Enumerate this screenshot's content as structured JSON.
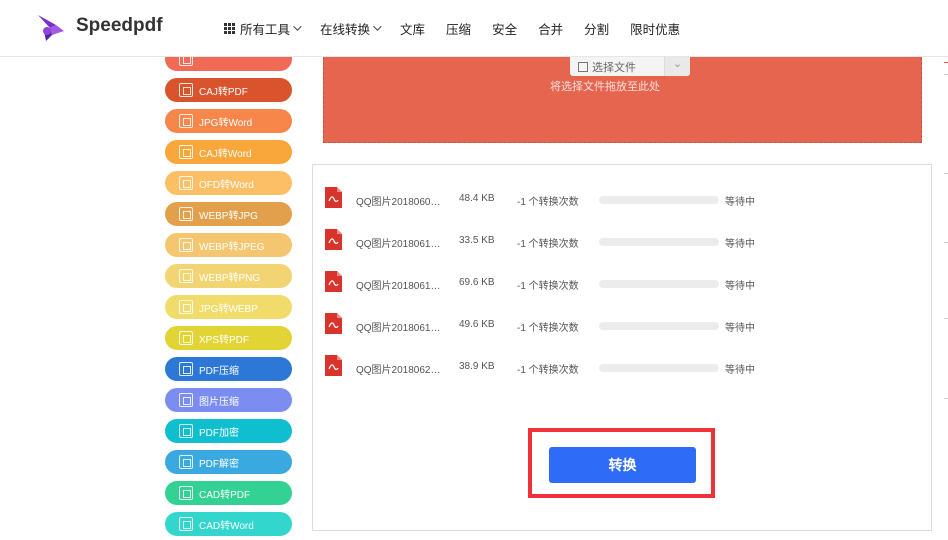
{
  "header": {
    "brand": "Speedpdf",
    "nav": [
      {
        "label": "所有工具",
        "has_grid_icon": true,
        "has_chevron": true
      },
      {
        "label": "在线转换",
        "has_grid_icon": false,
        "has_chevron": true
      },
      {
        "label": "文库",
        "has_grid_icon": false,
        "has_chevron": false
      },
      {
        "label": "压缩",
        "has_grid_icon": false,
        "has_chevron": false
      },
      {
        "label": "安全",
        "has_grid_icon": false,
        "has_chevron": false
      },
      {
        "label": "合并",
        "has_grid_icon": false,
        "has_chevron": false
      },
      {
        "label": "分割",
        "has_grid_icon": false,
        "has_chevron": false
      },
      {
        "label": "限时优惠",
        "has_grid_icon": false,
        "has_chevron": false
      }
    ]
  },
  "sidebar": {
    "items": [
      {
        "label": "",
        "color": "#f06a55"
      },
      {
        "label": "CAJ转PDF",
        "color": "#d9532c"
      },
      {
        "label": "JPG转Word",
        "color": "#f7864a"
      },
      {
        "label": "CAJ转Word",
        "color": "#f9a63a"
      },
      {
        "label": "OFD转Word",
        "color": "#fdbf66"
      },
      {
        "label": "WEBP转JPG",
        "color": "#e3a04c"
      },
      {
        "label": "WEBP转JPEG",
        "color": "#f4c670"
      },
      {
        "label": "WEBP转PNG",
        "color": "#f2d572"
      },
      {
        "label": "JPG转WEBP",
        "color": "#f1dc6b"
      },
      {
        "label": "XPS转PDF",
        "color": "#e3d436"
      },
      {
        "label": "PDF压缩",
        "color": "#2d78d6"
      },
      {
        "label": "图片压缩",
        "color": "#7b8df0"
      },
      {
        "label": "PDF加密",
        "color": "#10bfcf"
      },
      {
        "label": "PDF解密",
        "color": "#3aa9e0"
      },
      {
        "label": "CAD转PDF",
        "color": "#33d294"
      },
      {
        "label": "CAD转Word",
        "color": "#32d6cc"
      },
      {
        "label": "",
        "color": "#39c56a"
      }
    ]
  },
  "upload": {
    "select_label": "选择文件",
    "drop_hint": "将选择文件拖放至此处",
    "bg_color": "#e5654f"
  },
  "files": [
    {
      "name": "QQ图片2018060…",
      "size": "48.4 KB",
      "count": "-1 个转换次数",
      "progress": 0,
      "status": "等待中"
    },
    {
      "name": "QQ图片2018061…",
      "size": "33.5 KB",
      "count": "-1 个转换次数",
      "progress": 0,
      "status": "等待中"
    },
    {
      "name": "QQ图片2018061…",
      "size": "69.6 KB",
      "count": "-1 个转换次数",
      "progress": 0,
      "status": "等待中"
    },
    {
      "name": "QQ图片2018061…",
      "size": "49.6 KB",
      "count": "-1 个转换次数",
      "progress": 0,
      "status": "等待中"
    },
    {
      "name": "QQ图片2018062…",
      "size": "38.9 KB",
      "count": "-1 个转换次数",
      "progress": 0,
      "status": "等待中"
    }
  ],
  "convert_button": {
    "label": "转换",
    "color": "#2e6bf6"
  },
  "highlight_color": "#ee3237",
  "icons": {
    "file_icon": "pdf-file-icon",
    "logo": "speedpdf-logo"
  }
}
